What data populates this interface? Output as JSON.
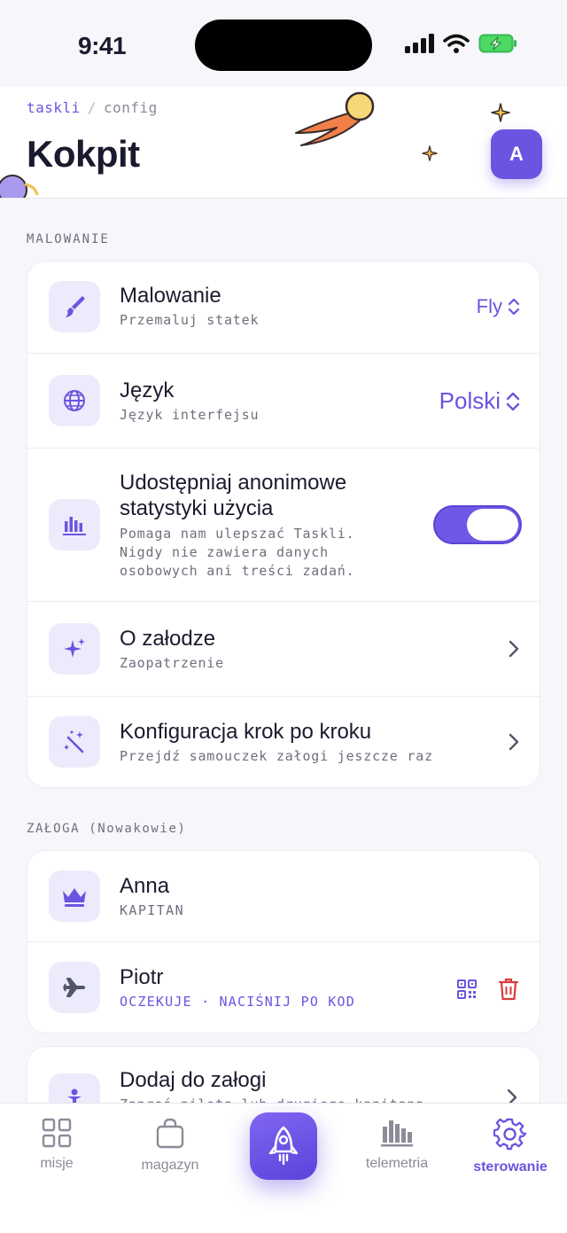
{
  "status_bar": {
    "time": "9:41"
  },
  "header": {
    "breadcrumb": {
      "app": "taskli",
      "separator": "/",
      "current": "config"
    },
    "title": "Kokpit",
    "avatar_initial": "A"
  },
  "sections": {
    "painting": {
      "label": "MALOWANIE",
      "rows": [
        {
          "title": "Malowanie",
          "subtitle": "Przemaluj statek",
          "value": "Fly",
          "icon": "paintbrush-icon"
        },
        {
          "title": "Język",
          "subtitle": "Język interfejsu",
          "value": "Polski",
          "icon": "globe-icon"
        },
        {
          "title_line1": "Udostępniaj anonimowe",
          "title_line2": "statystyki użycia",
          "subtitle_line1": "Pomaga nam ulepszać Taskli.",
          "subtitle_line2": "Nigdy nie zawiera danych",
          "subtitle_line3": "osobowych ani treści zadań.",
          "toggle_on": true,
          "icon": "bar-chart-icon"
        },
        {
          "title": "O załodze",
          "subtitle": "Zaopatrzenie",
          "icon": "sparkles-icon"
        },
        {
          "title": "Konfiguracja krok po kroku",
          "subtitle": "Przejdź samouczek załogi jeszcze raz",
          "icon": "magic-wand-icon"
        }
      ]
    },
    "crew": {
      "label": "ZAŁOGA (Nowakowie)",
      "members": [
        {
          "name": "Anna",
          "role": "KAPITAN",
          "icon": "crown-icon"
        },
        {
          "name": "Piotr",
          "status": "OCZEKUJE · NACIŚNIJ PO KOD",
          "icon": "airplane-icon"
        }
      ],
      "add": {
        "title": "Dodaj do załogi",
        "subtitle": "Zaproś pilota lub drugiego kapitana",
        "icon": "person-icon"
      }
    }
  },
  "tabbar": {
    "tabs": [
      {
        "label": "misje",
        "icon": "grid-icon"
      },
      {
        "label": "magazyn",
        "icon": "bag-icon"
      },
      {
        "label": "telemetria",
        "icon": "bars-icon"
      },
      {
        "label": "sterowanie",
        "icon": "gear-icon",
        "active": true
      }
    ],
    "center_icon": "rocket-icon"
  },
  "colors": {
    "accent": "#6b54e0",
    "danger": "#d93a3a",
    "icon_bg": "#ecebfb"
  }
}
